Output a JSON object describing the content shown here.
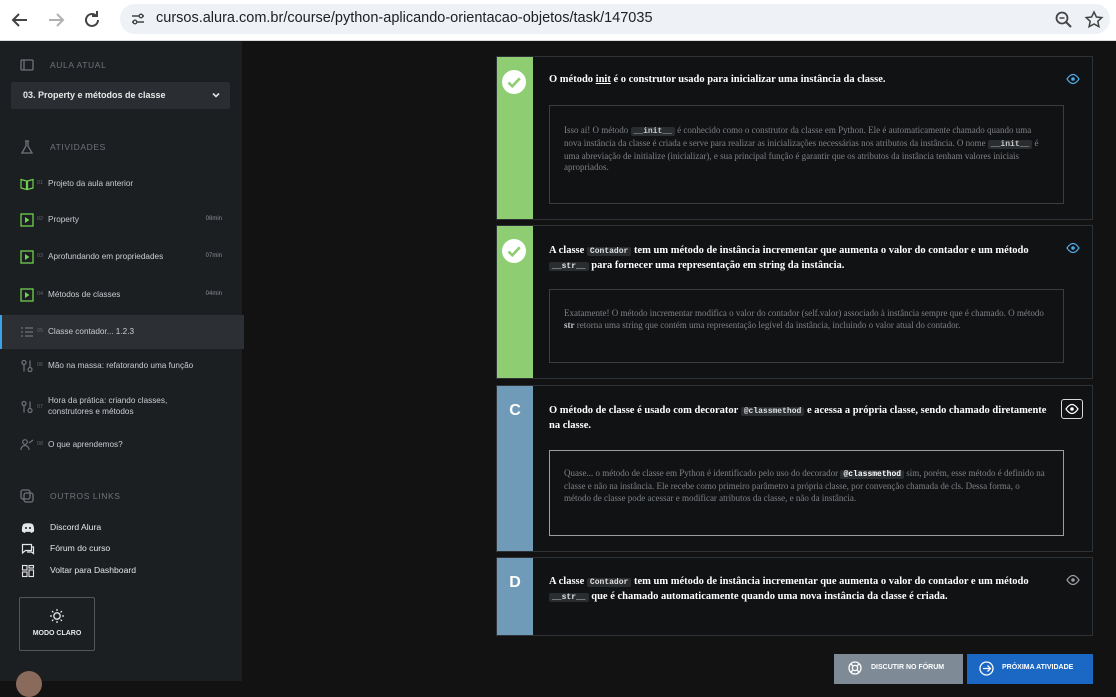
{
  "browser": {
    "url": "cursos.alura.com.br/course/python-aplicando-orientacao-objetos/task/147035"
  },
  "sidebar": {
    "current_lesson_label": "AULA ATUAL",
    "current_lesson": "03. Property e métodos de classe",
    "activities_label": "ATIVIDADES",
    "activities": [
      {
        "num": "01",
        "label": "Projeto da aula anterior",
        "duration": "",
        "icon": "book-icon"
      },
      {
        "num": "02",
        "label": "Property",
        "duration": "08min",
        "icon": "play-icon"
      },
      {
        "num": "03",
        "label": "Aprofundando em propriedades",
        "duration": "07min",
        "icon": "play-icon"
      },
      {
        "num": "04",
        "label": "Métodos de classes",
        "duration": "04min",
        "icon": "play-icon"
      },
      {
        "num": "05",
        "label": "Classe contador... 1.2.3",
        "duration": "",
        "icon": "list-icon"
      },
      {
        "num": "06",
        "label": "Mão na massa: refatorando uma função",
        "duration": "",
        "icon": "hands-on-icon"
      },
      {
        "num": "07",
        "label_line1": "Hora da prática: criando classes,",
        "label_line2": "construtores e métodos",
        "duration": "",
        "icon": "hands-on-icon"
      },
      {
        "num": "08",
        "label": "O que aprendemos?",
        "duration": "",
        "icon": "learned-icon"
      }
    ],
    "other_links_label": "OUTROS LINKS",
    "links": [
      {
        "label": "Discord Alura",
        "icon": "discord-icon"
      },
      {
        "label": "Fórum do curso",
        "icon": "forum-icon"
      },
      {
        "label": "Voltar para Dashboard",
        "icon": "dashboard-icon"
      }
    ],
    "mode_button": "MODO CLARO"
  },
  "cards": [
    {
      "marker": "check",
      "title_pre": "O método ",
      "title_bold": "init",
      "title_post": " é o construtor usado para inicializar uma instância da classe.",
      "answer_a": "Isso aí! O método ",
      "answer_code1": "__init__",
      "answer_b": " é conhecido como o construtor da classe em Python. Ele é automaticamente chamado quando uma nova instância da classe é criada e serve para realizar as inicializações necessárias nos atributos da instância. O nome ",
      "answer_code2": "__init__",
      "answer_c": " é uma abreviação de initialize (inicializar), e sua principal função é garantir que os atributos da instância tenham valores iniciais apropriados."
    },
    {
      "marker": "check",
      "title_a": "A classe ",
      "title_code1": "Contador",
      "title_b": " tem um método de instância incrementar que aumenta o valor do contador e um método ",
      "title_code2": "__str__",
      "title_c": " para fornecer uma representação em string da instância.",
      "answer_a": "Exatamente! O método incrementar modifica o valor do contador (self.valor) associado à instância sempre que é chamado. O método ",
      "answer_bold": "str",
      "answer_b": " retorna uma string que contém uma representação legível da instância, incluindo o valor atual do contador."
    },
    {
      "marker": "C",
      "title_a": "O método de classe é usado com decorator ",
      "title_code": "@classmethod",
      "title_b": " e acessa a própria classe, sendo chamado diretamente na classe.",
      "answer_a": "Quase... o método de classe em Python é identificado pelo uso do decorador ",
      "answer_code": "@classmethod",
      "answer_b": " sim, porém, esse método é definido na classe e não na instância. Ele recebe como primeiro parâmetro a própria classe, por convenção chamada de cls. Dessa forma, o método de classe pode acessar e modificar atributos da classe, e não da instância."
    },
    {
      "marker": "D",
      "title_a": "A classe ",
      "title_code1": "Contador",
      "title_b": " tem um método de instância incrementar que aumenta o valor do contador e um método ",
      "title_code2": "__str__",
      "title_c": " que é chamado automaticamente quando uma nova instância da classe é criada."
    }
  ],
  "buttons": {
    "forum": "DISCUTIR NO FÓRUM",
    "next": "PRÓXIMA ATIVIDADE"
  },
  "colors": {
    "correct": "#8fcd72",
    "option": "#6f9ab8",
    "sidebar": "#1c1f22",
    "primary": "#1a67c4"
  }
}
